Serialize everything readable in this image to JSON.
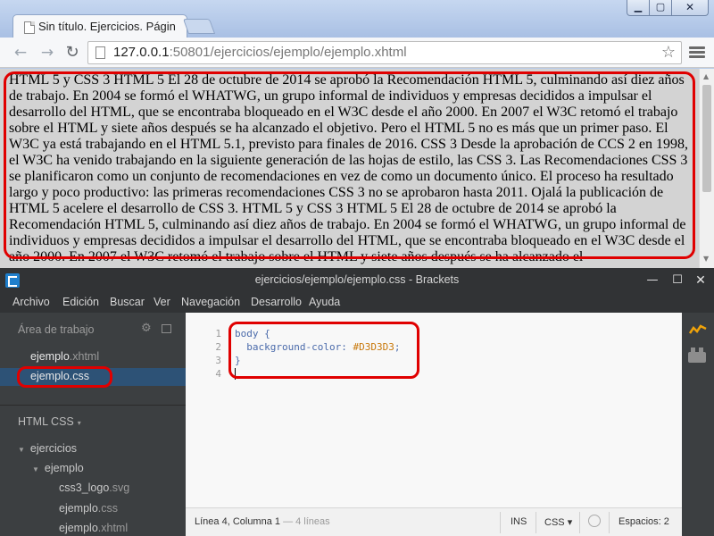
{
  "browser": {
    "tab_title": "Sin título. Ejercicios. Págin",
    "url_host": "127.0.0.1",
    "url_rest": ":50801/ejercicios/ejemplo/ejemplo.xhtml",
    "page_background": "#D3D3D3",
    "page_text": "HTML 5 y CSS 3 HTML 5 El 28 de octubre de 2014 se aprobó la Recomendación HTML 5, culminando así diez años de trabajo. En 2004 se formó el WHATWG, un grupo informal de individuos y empresas decididos a impulsar el desarrollo del HTML, que se encontraba bloqueado en el W3C desde el año 2000. En 2007 el W3C retomó el trabajo sobre el HTML y siete años después se ha alcanzado el objetivo. Pero el HTML 5 no es más que un primer paso. El W3C ya está trabajando en el HTML 5.1, previsto para finales de 2016. CSS 3 Desde la aprobación de CCS 2 en 1998, el W3C ha venido trabajando en la siguiente generación de las hojas de estilo, las CSS 3. Las Recomendaciones CSS 3 se planificaron como un conjunto de recomendaciones en vez de como un documento único. El proceso ha resultado largo y poco productivo: las primeras recomendaciones CSS 3 no se aprobaron hasta 2011. Ojalá la publicación de HTML 5 acelere el desarrollo de CSS 3. HTML 5 y CSS 3 HTML 5 El 28 de octubre de 2014 se aprobó la Recomendación HTML 5, culminando así diez años de trabajo. En 2004 se formó el WHATWG, un grupo informal de individuos y empresas decididos a impulsar el desarrollo del HTML, que se encontraba bloqueado en el W3C desde el año 2000. En 2007 el W3C retomó el trabajo sobre el HTML y siete años después se ha alcanzado el"
  },
  "brackets": {
    "title": "ejercicios/ejemplo/ejemplo.css - Brackets",
    "menu": [
      "Archivo",
      "Edición",
      "Buscar",
      "Ver",
      "Navegación",
      "Desarrollo",
      "Ayuda"
    ],
    "working_set_title": "Área de trabajo",
    "working_files": [
      {
        "name": "ejemplo",
        "ext": ".xhtml"
      },
      {
        "name": "ejemplo",
        "ext": ".css"
      }
    ],
    "project_name": "HTML CSS",
    "tree": [
      {
        "label": "ejercicios",
        "type": "folder"
      },
      {
        "label": "ejemplo",
        "type": "folder"
      },
      {
        "name": "css3_logo",
        "ext": ".svg",
        "type": "file"
      },
      {
        "name": "ejemplo",
        "ext": ".css",
        "type": "file"
      },
      {
        "name": "ejemplo",
        "ext": ".xhtml",
        "type": "file"
      }
    ],
    "code": {
      "line_numbers": [
        "1",
        "2",
        "3",
        "4"
      ],
      "selector": "body",
      "open_brace": "{",
      "property": "background-color",
      "colon": ":",
      "value": "#D3D3D3",
      "semicolon": ";",
      "close_brace": "}"
    },
    "status": {
      "position": "Línea 4, Columna 1",
      "lines": " — 4 líneas",
      "mode": "INS",
      "language": "CSS",
      "spaces": "Espacios:  2"
    },
    "colors": {
      "highlight": "#E00000",
      "value_color": "#C8780A",
      "keyword_color": "#4A6AAA"
    }
  }
}
